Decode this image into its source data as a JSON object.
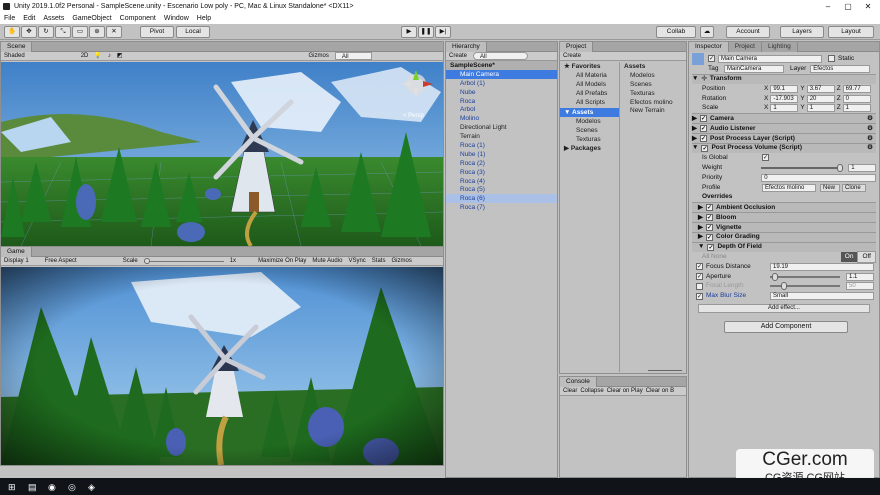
{
  "window": {
    "title": "Unity 2019.1.0f2 Personal - SampleScene.unity - Escenario Low poly - PC, Mac & Linux Standalone* <DX11>"
  },
  "menu": [
    "File",
    "Edit",
    "Assets",
    "GameObject",
    "Component",
    "Window",
    "Help"
  ],
  "toolbar": {
    "pivot": "Pivot",
    "local": "Local",
    "collab": "Collab",
    "account": "Account",
    "layers": "Layers",
    "layout": "Layout"
  },
  "scene": {
    "tab": "Scene",
    "shading": "Shaded",
    "mode2d": "2D",
    "gizmos": "Gizmos",
    "search": "All",
    "persp": "< Persp"
  },
  "game": {
    "tab": "Game",
    "display": "Display 1",
    "aspect": "Free Aspect",
    "scale_label": "Scale",
    "scale_value": "1x",
    "max_on_play": "Maximize On Play",
    "mute": "Mute Audio",
    "vsync": "VSync",
    "stats": "Stats",
    "gizmos": "Gizmos"
  },
  "hierarchy": {
    "tab": "Hierarchy",
    "create": "Create",
    "search": "All",
    "items": [
      {
        "label": "SampleScene*",
        "style": "scene"
      },
      {
        "label": "Main Camera",
        "style": "sel"
      },
      {
        "label": "Arbol (1)",
        "style": ""
      },
      {
        "label": "Nube",
        "style": ""
      },
      {
        "label": "Roca",
        "style": ""
      },
      {
        "label": "Arbol",
        "style": ""
      },
      {
        "label": "Molino",
        "style": ""
      },
      {
        "label": "Directional Light",
        "style": "dark"
      },
      {
        "label": "Terrain",
        "style": "dark"
      },
      {
        "label": "Roca (1)",
        "style": ""
      },
      {
        "label": "Nube (1)",
        "style": ""
      },
      {
        "label": "Roca (2)",
        "style": ""
      },
      {
        "label": "Roca (3)",
        "style": ""
      },
      {
        "label": "Roca (4)",
        "style": ""
      },
      {
        "label": "Roca (5)",
        "style": ""
      },
      {
        "label": "Roca (6)",
        "style": "hover"
      },
      {
        "label": "Roca (7)",
        "style": ""
      }
    ]
  },
  "project": {
    "tab": "Project",
    "create": "Create",
    "favorites": {
      "label": "Favorites",
      "items": [
        "All Materia",
        "All Models",
        "All Prefabs",
        "All Scripts"
      ]
    },
    "assets_tree": {
      "label": "Assets",
      "items": [
        "Modelos",
        "Scenes",
        "Texturas"
      ]
    },
    "packages": "Packages",
    "assets_header": "Assets",
    "assets_list": [
      "Modelos",
      "Scenes",
      "Texturas",
      "Efectos molino",
      "New Terrain"
    ]
  },
  "console": {
    "tab": "Console",
    "buttons": [
      "Clear",
      "Collapse",
      "Clear on Play",
      "Clear on B"
    ]
  },
  "inspector": {
    "tabs": [
      "Inspector",
      "Project",
      "Lighting"
    ],
    "object_name": "Main Camera",
    "static_label": "Static",
    "tag_label": "Tag",
    "tag_value": "MainCamera",
    "layer_label": "Layer",
    "layer_value": "Efectos",
    "transform": {
      "title": "Transform",
      "rows": [
        {
          "label": "Position",
          "x": "99.1",
          "y": "3.67",
          "z": "69.77"
        },
        {
          "label": "Rotation",
          "x": "-17.903",
          "y": "20",
          "z": "0"
        },
        {
          "label": "Scale",
          "x": "1",
          "y": "1",
          "z": "1"
        }
      ]
    },
    "components": [
      "Camera",
      "Audio Listener",
      "Post Process Layer (Script)",
      "Post Process Volume (Script)"
    ],
    "volume": {
      "is_global": "Is Global",
      "weight_label": "Weight",
      "weight_value": "1",
      "priority_label": "Priority",
      "priority_value": "0",
      "profile_label": "Profile",
      "profile_value": "Efectos molino",
      "new_btn": "New",
      "clone_btn": "Clone",
      "weight_level": 1.0
    },
    "overrides_label": "Overrides",
    "effects": [
      "Ambient Occlusion",
      "Bloom",
      "Vignette",
      "Color Grading",
      "Depth Of Field"
    ],
    "dof": {
      "all_none": "All None",
      "on": "On",
      "off": "Off",
      "rows": [
        {
          "label": "Focus Distance",
          "value": "19.19",
          "slider": false,
          "level": null,
          "disabled": false
        },
        {
          "label": "Aperture",
          "value": "1.1",
          "slider": true,
          "level": 0.03,
          "disabled": false
        },
        {
          "label": "Focal Length",
          "value": "50",
          "slider": true,
          "level": 0.17,
          "disabled": true
        }
      ],
      "blur_label": "Max Blur Size",
      "blur_value": "Small"
    },
    "add_effect": "Add effect...",
    "add_component": "Add Component"
  },
  "watermark": {
    "text": "CGer.com",
    "sub": "CG资源 CG网站"
  },
  "colors": {
    "accent": "#3d7be0",
    "link": "#1b3e9a",
    "sky": "#5fa0d8",
    "grass": "#2f8a2a"
  }
}
